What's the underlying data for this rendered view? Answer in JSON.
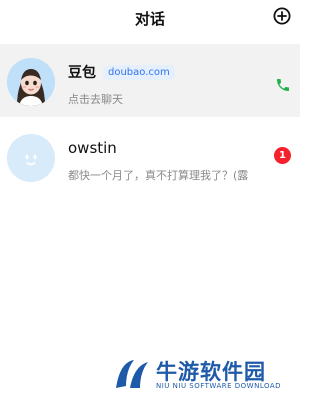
{
  "header": {
    "title": "对话",
    "add_icon": "plus-circle-icon"
  },
  "conversations": [
    {
      "name": "豆包",
      "tag": "doubao.com",
      "subtitle": "点击去聊天",
      "avatar_icon": "cartoon-girl-avatar",
      "action_icon": "phone-icon",
      "accent_color": "#22b14c",
      "pinned": true
    },
    {
      "name": "owstin",
      "subtitle": "都快一个月了，真不打算理我了？(露",
      "avatar_icon": "smiley-face-avatar",
      "unread": "1",
      "badge_color": "#f5222d"
    }
  ],
  "watermark": {
    "title": "牛游软件园",
    "subtitle": "NIU NIU SOFTWARE DOWNLOAD"
  },
  "colors": {
    "tag_text": "#2f73f0",
    "tag_bg": "#e6f0fd",
    "watermark": "#1e5aa8"
  }
}
